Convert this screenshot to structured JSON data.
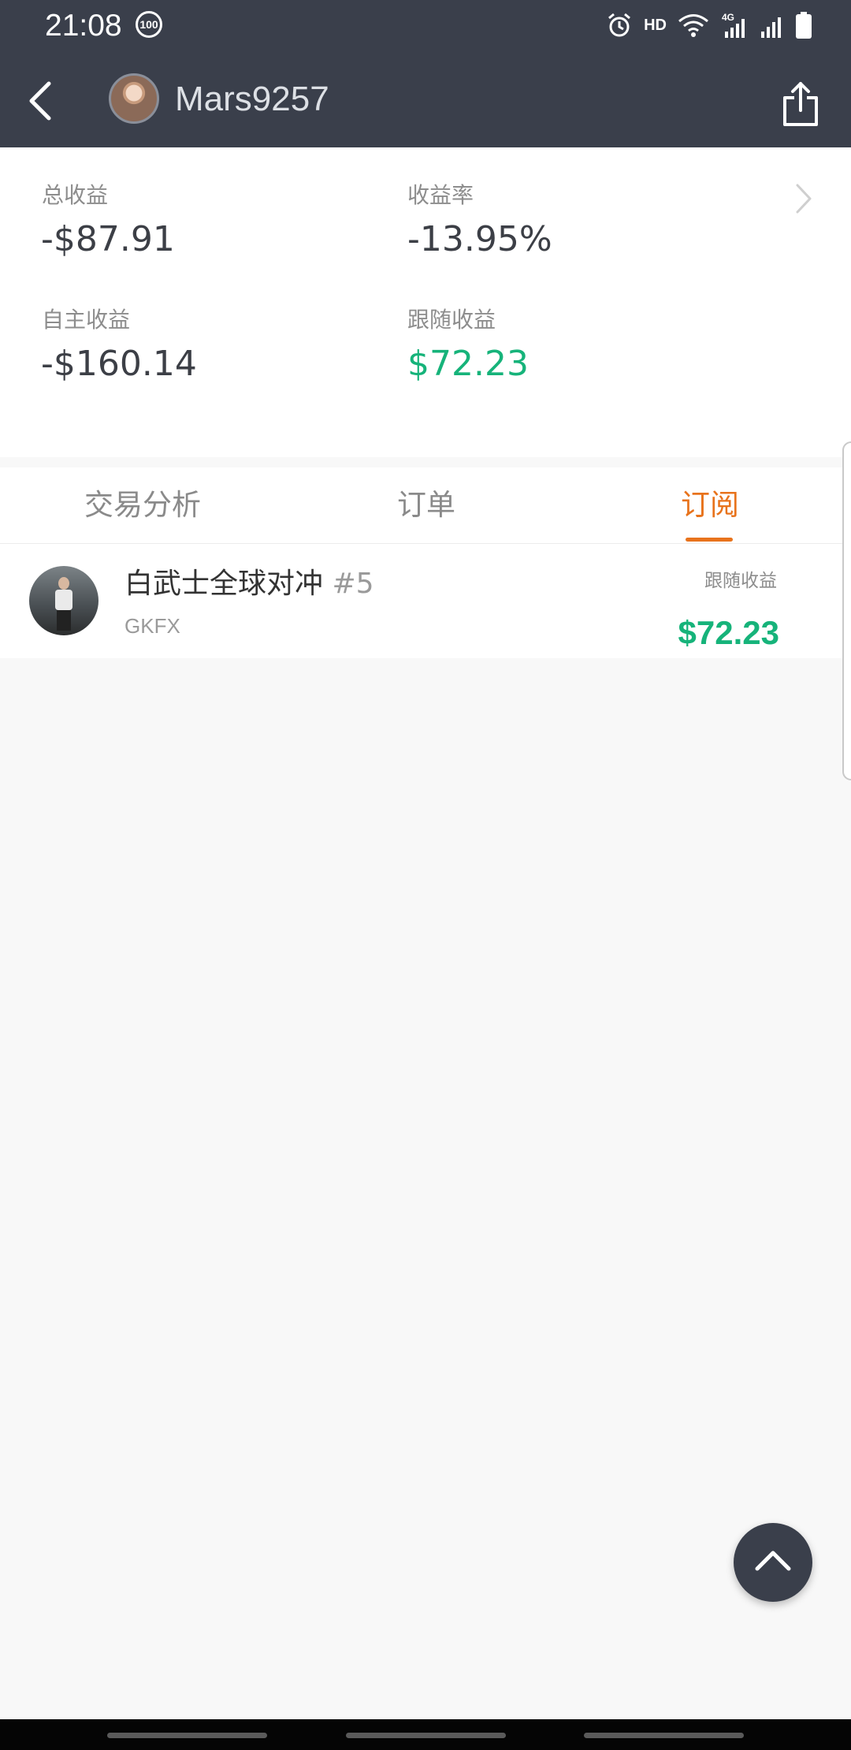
{
  "status_bar": {
    "time": "21:08",
    "battery_badge": "100",
    "network_hd": "HD",
    "icons": [
      "alarm-icon",
      "wifi-icon",
      "signal-4g-icon",
      "signal-icon",
      "battery-icon"
    ]
  },
  "header": {
    "username": "Mars9257",
    "icons": [
      "back-arrow-icon",
      "share-icon"
    ]
  },
  "stats": {
    "total_label": "总收益",
    "total_value": "-$87.91",
    "rate_label": "收益率",
    "rate_value": "-13.95%",
    "self_label": "自主收益",
    "self_value": "-$160.14",
    "follow_label": "跟随收益",
    "follow_value": "$72.23"
  },
  "tabs": [
    {
      "label": "交易分析",
      "active": false
    },
    {
      "label": "订单",
      "active": false
    },
    {
      "label": "订阅",
      "active": true
    }
  ],
  "subscriptions": [
    {
      "name": "白武士全球对冲",
      "number": "#5",
      "broker": "GKFX",
      "profit_label": "跟随收益",
      "profit_value": "$72.23"
    }
  ],
  "colors": {
    "header_bg": "#3a3f4b",
    "accent_orange": "#e8731c",
    "positive_green": "#16b37a"
  }
}
